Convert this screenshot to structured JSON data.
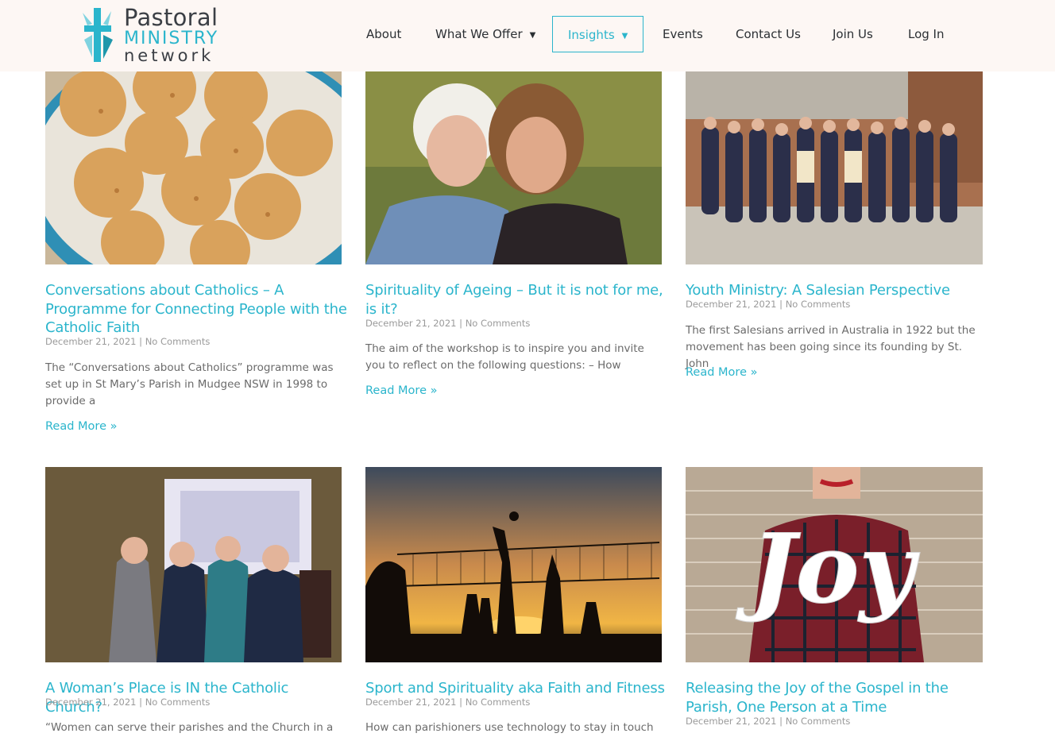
{
  "brand": {
    "line1": "Pastoral",
    "line2": "MINISTRY",
    "line3": "network",
    "accent_color": "#2bb5cc",
    "text_color": "#3b3f45"
  },
  "nav": {
    "items": [
      {
        "label": "About",
        "dropdown": false,
        "active": false
      },
      {
        "label": "What We Offer",
        "dropdown": true,
        "active": false
      },
      {
        "label": "Insights",
        "dropdown": true,
        "active": true
      },
      {
        "label": "Events",
        "dropdown": false,
        "active": false
      },
      {
        "label": "Contact Us",
        "dropdown": false,
        "active": false
      },
      {
        "label": "Join Us",
        "dropdown": false,
        "active": false
      },
      {
        "label": "Log In",
        "dropdown": false,
        "active": false
      }
    ],
    "caret_icon": "caret-down-icon"
  },
  "posts": [
    {
      "title": "Conversations about Catholics – A Programme for Connecting People with the Catholic Faith",
      "date": "December 21, 2021",
      "comments": "No Comments",
      "excerpt": "The “Conversations about Catholics” programme was set up in St Mary’s Parish in Mudgee NSW in 1998 to provide a",
      "read_more": "Read More »",
      "image": "muffins-photo"
    },
    {
      "title": "Spirituality of Ageing – But it is not for me, is it?",
      "date": "December 21, 2021",
      "comments": "No Comments",
      "excerpt": "The aim of the workshop is to inspire you and invite you to reflect on the following questions: – How",
      "read_more": "Read More »",
      "image": "two-women-hugging-photo"
    },
    {
      "title": "Youth Ministry: A Salesian Perspective",
      "date": "December 21, 2021",
      "comments": "No Comments",
      "excerpt": "The first Salesians arrived in Australia in 1922 but the movement has been going since its founding by St. John",
      "read_more": "Read More »",
      "image": "youth-group-photo"
    },
    {
      "title": "A Woman’s Place is IN the Catholic Church?",
      "date": "December 21, 2021",
      "comments": "No Comments",
      "excerpt": "“Women can serve their parishes and the Church in a",
      "read_more": "",
      "image": "women-conference-photo"
    },
    {
      "title": "Sport and Spirituality aka Faith and Fitness",
      "date": "December 21, 2021",
      "comments": "No Comments",
      "excerpt": "How can parishioners use technology to stay in touch",
      "read_more": "",
      "image": "volleyball-sunset-photo"
    },
    {
      "title": "Releasing the Joy of the Gospel in the Parish, One Person at a Time",
      "date": "December 21, 2021",
      "comments": "No Comments",
      "excerpt": "",
      "read_more": "",
      "image": "joy-sign-photo"
    }
  ]
}
